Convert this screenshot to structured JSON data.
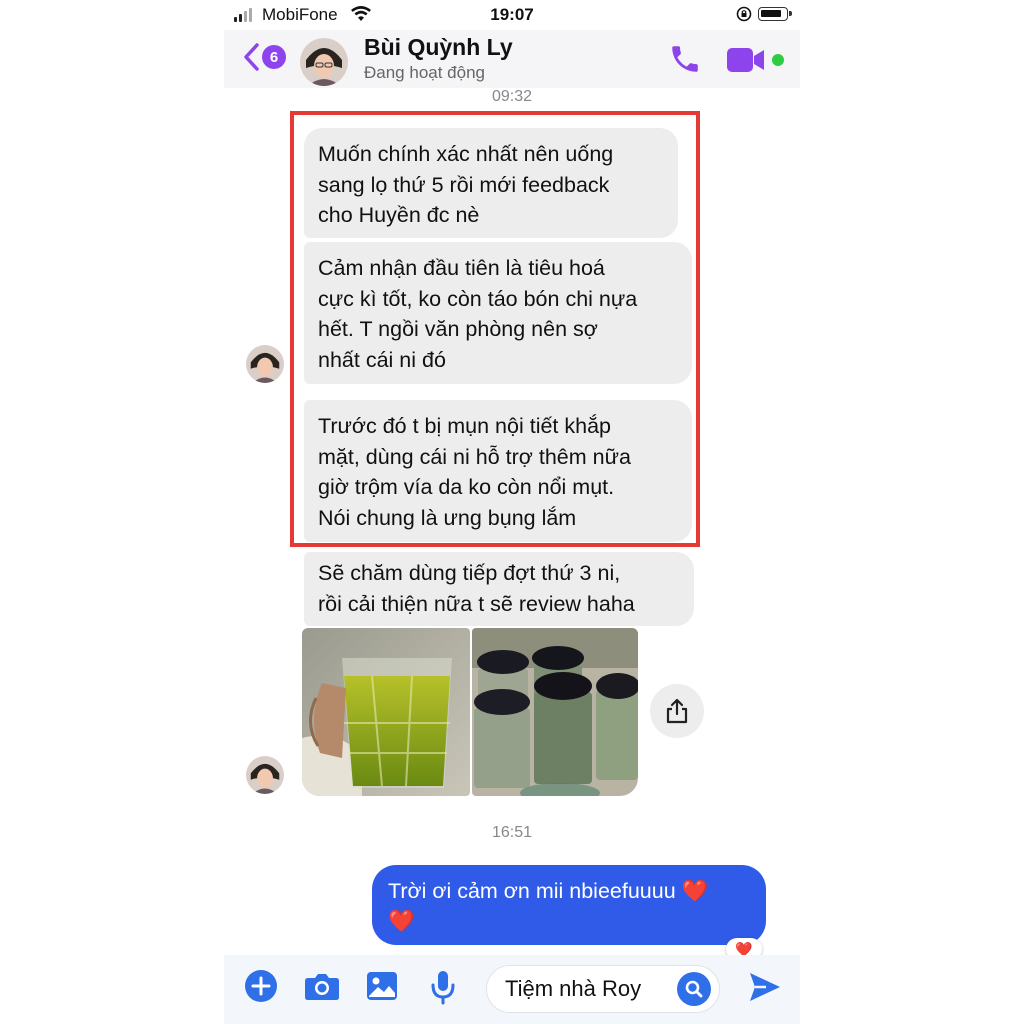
{
  "status_bar": {
    "carrier": "MobiFone",
    "time": "19:07"
  },
  "header": {
    "back_count": "6",
    "contact_name": "Bùi Quỳnh Ly",
    "contact_status": "Đang hoạt động",
    "icons": [
      "chevron-left-icon",
      "phone-icon",
      "video-camera-icon"
    ]
  },
  "conversation": {
    "time_1": "09:32",
    "received_messages": [
      {
        "lines": [
          "Muốn chính xác nhất nên uống",
          "sang lọ thứ 5 rồi mới feedback",
          "cho Huyền đc nè"
        ]
      },
      {
        "lines": [
          "Cảm nhận đầu tiên là tiêu hoá",
          "cực kì tốt, ko còn táo bón chi nựa",
          "hết. T ngồi văn phòng nên sợ",
          "nhất cái ni đó"
        ]
      },
      {
        "lines": [
          "Trước đó t bị mụn nội tiết khắp",
          "mặt, dùng cái ni hỗ trợ thêm nữa",
          "giờ trộm vía da ko còn nổi mụt.",
          "Nói chung là ưng bụng lắm"
        ]
      },
      {
        "lines": [
          "Sẽ chăm dùng tiếp đợt thứ 3 ni,",
          "rồi cải thiện nữa t sẽ review haha"
        ]
      }
    ],
    "photos": [
      "glass-of-green-juice",
      "jars-of-green-powder"
    ],
    "time_2": "16:51",
    "sent_message": {
      "line1": "Trời ơi cảm ơn mii nbieefuuuu",
      "line2": ""
    },
    "reaction": "❤️",
    "accent_color": "#2f5be8",
    "highlight_color": "#e53935"
  },
  "composer": {
    "input_value": "Tiệm nhà Roy",
    "icons": [
      "plus-icon",
      "camera-icon",
      "image-icon",
      "microphone-icon",
      "search-icon",
      "send-icon"
    ]
  }
}
